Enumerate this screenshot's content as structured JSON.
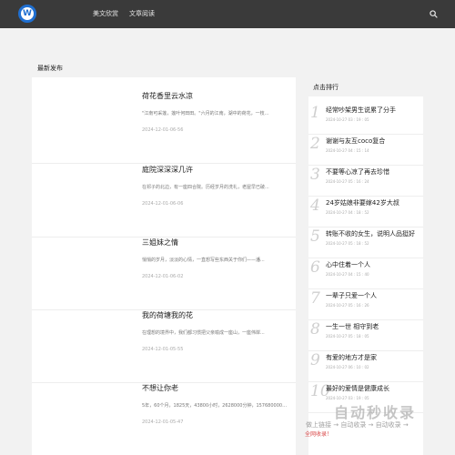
{
  "header": {
    "logo_text": "W",
    "nav": [
      "美文欣赏",
      "文章阅读"
    ]
  },
  "main": {
    "section_title": "最新发布",
    "articles": [
      {
        "title": "荷花香里云水凉",
        "excerpt": "\"江南可采莲，莲叶何田田。\"六月的江南，湖中的荷花，一枝...",
        "date": "2024-12-01-06-56"
      },
      {
        "title": "庭院深深深几许",
        "excerpt": "在祁子的北边，有一座四合院。历经岁月的洗礼，老屋早已破...",
        "date": "2024-12-01-06-06"
      },
      {
        "title": "三姐妹之情",
        "excerpt": "悄悄的岁月，淡淡的心情，一直想写些东西关于你们——潘...",
        "date": "2024-12-01-06-02"
      },
      {
        "title": "我的荷塘我的花",
        "excerpt": "在理想的境界中，我们都习惯把父亲喻成一座山，一座伟岸...",
        "date": "2024-12-01-05-55"
      },
      {
        "title": "不想让你老",
        "excerpt": "5年，60个月，1825天，43800小时，2628000分钟，157680000秒，...",
        "date": "2024-12-01-05-47"
      }
    ]
  },
  "sidebar": {
    "title": "点击排行",
    "items": [
      {
        "num": "1",
        "title": "经常吵架男生说累了分手",
        "date": "2024-10-27 03 : 19 : 05"
      },
      {
        "num": "2",
        "title": "谢谢与友互coco复合",
        "date": "2024-10-27 04 : 15 : 14"
      },
      {
        "num": "3",
        "title": "不要等心凉了再去珍惜",
        "date": "2024-10-27 05 : 16 : 24"
      },
      {
        "num": "4",
        "title": "24岁姑娘非要嫁42岁大叔",
        "date": "2024-10-27 04 : 18 : 52"
      },
      {
        "num": "5",
        "title": "转账不收的女生，说明人品挺好",
        "date": "2024-10-27 05 : 18 : 52"
      },
      {
        "num": "6",
        "title": "心中住着一个人",
        "date": "2024-10-27 04 : 15 : 40"
      },
      {
        "num": "7",
        "title": "一辈子只爱一个人",
        "date": "2024-10-27 05 : 16 : 26"
      },
      {
        "num": "8",
        "title": "一生一世 相守到老",
        "date": "2024-10-27 05 : 18 : 05"
      },
      {
        "num": "9",
        "title": "有爱的地方才是家",
        "date": "2024-10-27 06 : 10 : 02"
      },
      {
        "num": "10",
        "title": "最好的爱情是健康成长",
        "date": "2024-10-27 03 : 19 : 05"
      }
    ]
  },
  "watermark": {
    "title": "自动秒收录",
    "sub": "做上链接 → 自动收录 → 自动收录 →",
    "red": "全网收录！"
  },
  "colors": {
    "topbar": "#3a3a3a",
    "page_bg": "#f2f2f2",
    "logo_accent": "#1f6fd1"
  }
}
